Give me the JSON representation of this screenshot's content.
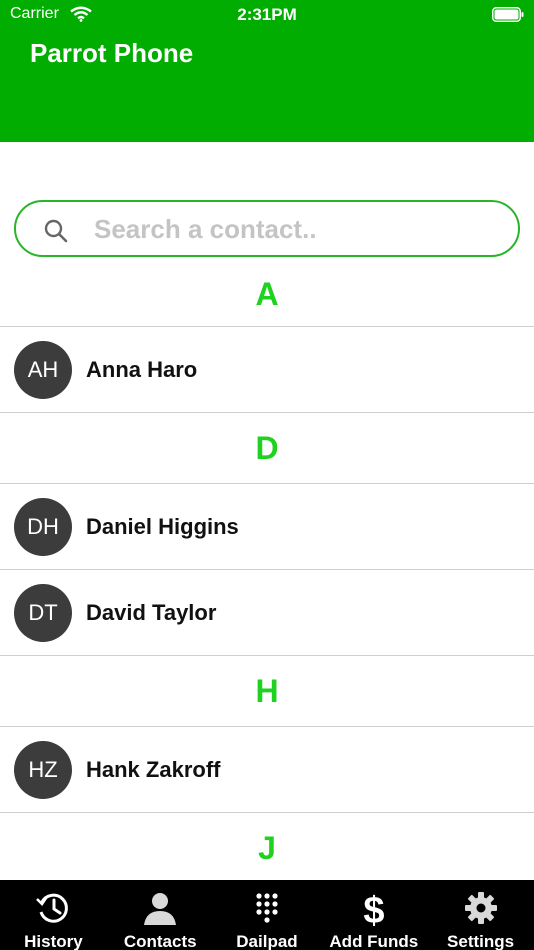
{
  "status_bar": {
    "carrier": "Carrier",
    "time": "2:31PM"
  },
  "header": {
    "title": "Parrot Phone",
    "color": "#00ad00"
  },
  "search": {
    "placeholder": "Search a contact.."
  },
  "sections": [
    {
      "letter": "A",
      "contacts": [
        {
          "initials": "AH",
          "name": "Anna Haro"
        }
      ]
    },
    {
      "letter": "D",
      "contacts": [
        {
          "initials": "DH",
          "name": "Daniel Higgins"
        },
        {
          "initials": "DT",
          "name": "David Taylor"
        }
      ]
    },
    {
      "letter": "H",
      "contacts": [
        {
          "initials": "HZ",
          "name": "Hank Zakroff"
        }
      ]
    },
    {
      "letter": "J",
      "contacts": []
    }
  ],
  "tabs": [
    {
      "label": "History",
      "icon": "history-icon"
    },
    {
      "label": "Contacts",
      "icon": "person-icon"
    },
    {
      "label": "Dailpad",
      "icon": "dialpad-icon"
    },
    {
      "label": "Add Funds",
      "icon": "dollar-icon"
    },
    {
      "label": "Settings",
      "icon": "gear-icon"
    }
  ],
  "colors": {
    "accent": "#1fd21f",
    "avatar": "#3c3c3c",
    "tab_bar": "#000000"
  }
}
